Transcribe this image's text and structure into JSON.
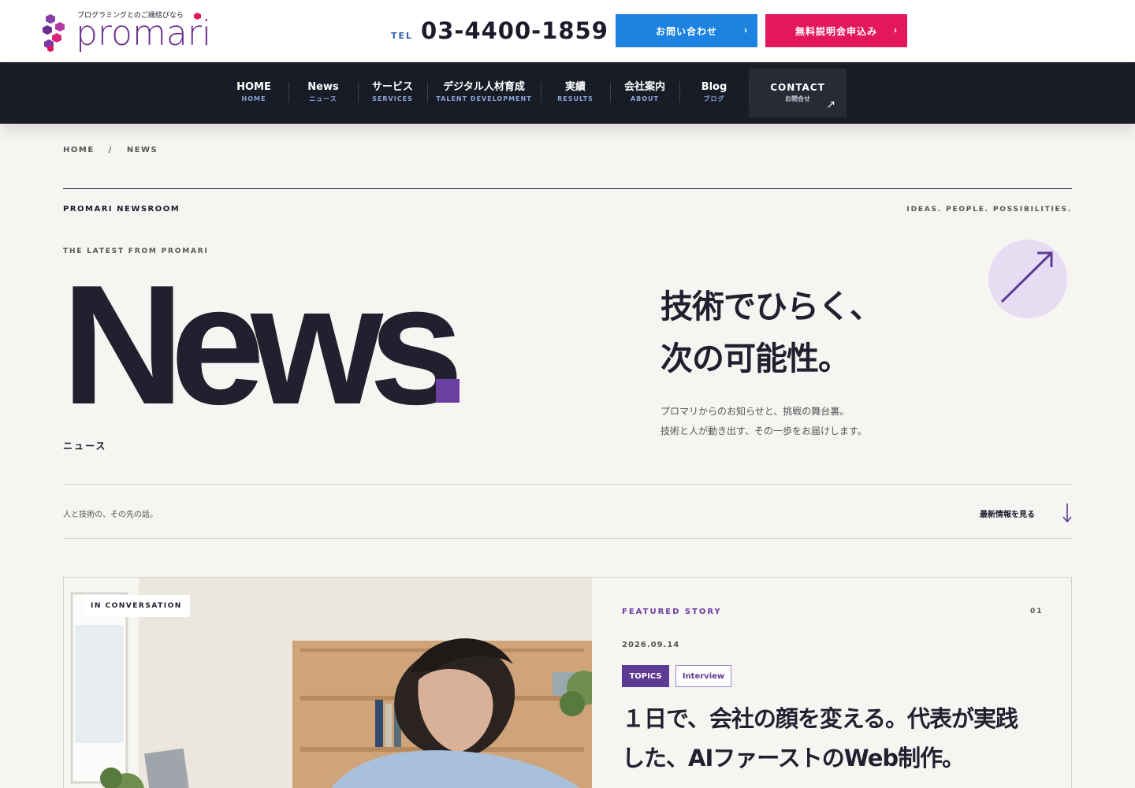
{
  "header": {
    "logo_tagline": "プログラミングとのご縁結びなら",
    "logo_word": "promari",
    "tel_label": "TEL",
    "tel_number": "03-4400-1859",
    "contact_button": "お問い合わせ",
    "apply_button": "無料説明会申込み",
    "chevron": "›",
    "colors": {
      "contact": "#1d82e0",
      "apply": "#e3175e",
      "logo": "#6b2f8f"
    }
  },
  "nav": {
    "items": [
      {
        "jp": "HOME",
        "en": "HOME"
      },
      {
        "jp": "News",
        "en": "ニュース"
      },
      {
        "jp": "サービス",
        "en": "SERVICES"
      },
      {
        "jp": "デジタル人材育成",
        "en": "TALENT DEVELOPMENT"
      },
      {
        "jp": "実績",
        "en": "RESULTS"
      },
      {
        "jp": "会社案内",
        "en": "ABOUT"
      },
      {
        "jp": "Blog",
        "en": "ブログ"
      }
    ],
    "contact": {
      "jp": "CONTACT",
      "en": "お問合せ",
      "arrow": "↗"
    }
  },
  "breadcrumb": {
    "home": "HOME",
    "separator": "/",
    "current": "NEWS"
  },
  "hero": {
    "newsroom": "PROMARI NEWSROOM",
    "tagline": "IDEAS. PEOPLE. POSSIBILITIES.",
    "eyebrow": "THE LATEST FROM PROMARI",
    "word": "News",
    "jp_label": "ニュース",
    "headline_line1": "技術でひらく、",
    "headline_line2": "次の可能性。",
    "lead_line1": "プロマリからのお知らせと、挑戦の舞台裏。",
    "lead_line2": "技術と人が動き出す、その一歩をお届けします。",
    "accent": "#6a3fa0"
  },
  "strip": {
    "left": "人と技術の、その先の話。",
    "right": "最新情報を見る"
  },
  "featured": {
    "photo_badge": "IN CONVERSATION",
    "label": "FEATURED STORY",
    "number": "01",
    "date": "2026.09.14",
    "tags": [
      "TOPICS",
      "Interview"
    ],
    "title_line1": "１日で、会社の顔を変える。代表が実践",
    "title_line2": "した、AIファーストのWeb制作。"
  }
}
